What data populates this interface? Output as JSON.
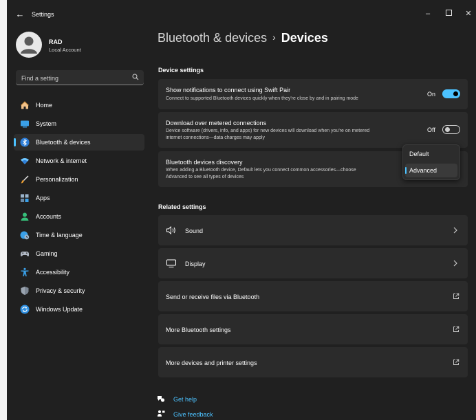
{
  "window": {
    "title": "Settings"
  },
  "user": {
    "name": "RAD",
    "account_type": "Local Account"
  },
  "search": {
    "placeholder": "Find a setting"
  },
  "sidebar": {
    "items": [
      {
        "label": "Home",
        "icon": "home-icon"
      },
      {
        "label": "System",
        "icon": "system-icon"
      },
      {
        "label": "Bluetooth & devices",
        "icon": "bluetooth-icon",
        "active": true
      },
      {
        "label": "Network & internet",
        "icon": "wifi-icon"
      },
      {
        "label": "Personalization",
        "icon": "brush-icon"
      },
      {
        "label": "Apps",
        "icon": "apps-icon"
      },
      {
        "label": "Accounts",
        "icon": "person-icon"
      },
      {
        "label": "Time & language",
        "icon": "globe-clock-icon"
      },
      {
        "label": "Gaming",
        "icon": "gamepad-icon"
      },
      {
        "label": "Accessibility",
        "icon": "accessibility-icon"
      },
      {
        "label": "Privacy & security",
        "icon": "shield-icon"
      },
      {
        "label": "Windows Update",
        "icon": "update-icon"
      }
    ]
  },
  "breadcrumb": {
    "parent": "Bluetooth & devices",
    "separator": "›",
    "current": "Devices"
  },
  "device_settings": {
    "heading": "Device settings",
    "swift_pair": {
      "title": "Show notifications to connect using Swift Pair",
      "description": "Connect to supported Bluetooth devices quickly when they're close by and in pairing mode",
      "state_label": "On",
      "value": true
    },
    "metered": {
      "title": "Download over metered connections",
      "description_line1": "Device software (drivers, info, and apps) for new devices will download when you're on metered",
      "description_line2": "internet connections—data charges may apply",
      "state_label": "Off",
      "value": false
    },
    "discovery": {
      "title": "Bluetooth devices discovery",
      "description_line1": "When adding a Bluetooth device, Default lets you connect common accessories—choose",
      "description_line2": "Advanced to see all types of devices",
      "options": [
        "Default",
        "Advanced"
      ],
      "selected": "Advanced"
    }
  },
  "related_settings": {
    "heading": "Related settings",
    "items": [
      {
        "label": "Sound",
        "icon": "speaker-icon",
        "action": "chevron"
      },
      {
        "label": "Display",
        "icon": "monitor-icon",
        "action": "chevron"
      },
      {
        "label": "Send or receive files via Bluetooth",
        "action": "external"
      },
      {
        "label": "More Bluetooth settings",
        "action": "external"
      },
      {
        "label": "More devices and printer settings",
        "action": "external"
      }
    ]
  },
  "footer_links": {
    "help": "Get help",
    "feedback": "Give feedback"
  },
  "colors": {
    "accent": "#4cc2ff",
    "background": "#202020",
    "card": "#2b2b2b"
  }
}
